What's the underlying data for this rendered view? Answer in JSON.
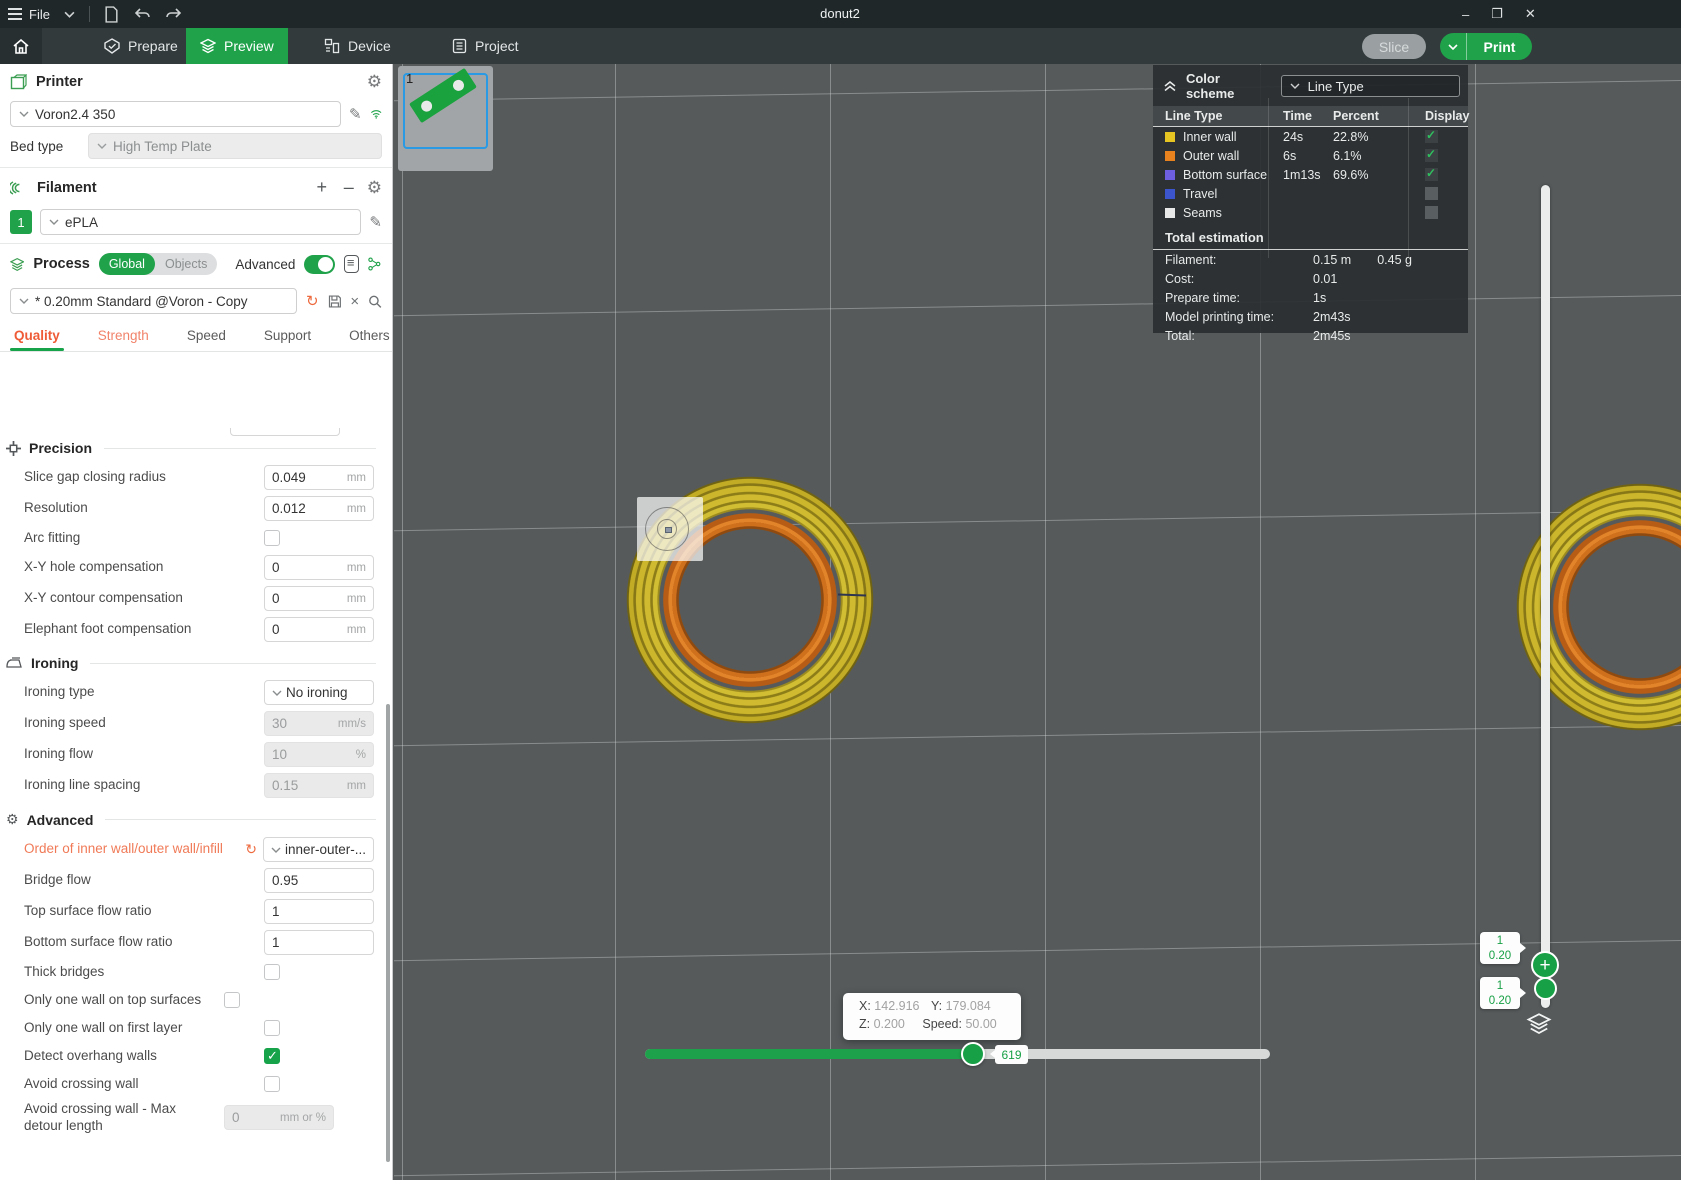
{
  "window": {
    "title": "donut2",
    "minimize": "–",
    "maximize": "❐",
    "close": "✕"
  },
  "menubar": {
    "file_label": "File"
  },
  "nav": {
    "tabs": [
      {
        "label": "Prepare"
      },
      {
        "label": "Preview"
      },
      {
        "label": "Device"
      },
      {
        "label": "Project"
      }
    ],
    "slice_label": "Slice",
    "print_label": "Print"
  },
  "printer": {
    "section_title": "Printer",
    "name": "Voron2.4 350",
    "bed_type_label": "Bed type",
    "bed_type": "High Temp Plate"
  },
  "filament": {
    "section_title": "Filament",
    "slot": "1",
    "name": "ePLA",
    "add": "+",
    "remove": "–"
  },
  "process": {
    "section_title": "Process",
    "global_label": "Global",
    "objects_label": "Objects",
    "advanced_label": "Advanced",
    "preset": "* 0.20mm Standard @Voron - Copy",
    "tabs": [
      "Quality",
      "Strength",
      "Speed",
      "Support",
      "Others"
    ]
  },
  "settings": {
    "precision": {
      "title": "Precision",
      "rows": [
        {
          "label": "Slice gap closing radius",
          "value": "0.049",
          "unit": "mm"
        },
        {
          "label": "Resolution",
          "value": "0.012",
          "unit": "mm"
        },
        {
          "label": "Arc fitting",
          "checked": false
        },
        {
          "label": "X-Y hole compensation",
          "value": "0",
          "unit": "mm"
        },
        {
          "label": "X-Y contour compensation",
          "value": "0",
          "unit": "mm"
        },
        {
          "label": "Elephant foot compensation",
          "value": "0",
          "unit": "mm"
        }
      ]
    },
    "ironing": {
      "title": "Ironing",
      "rows": [
        {
          "label": "Ironing type",
          "value": "No ironing"
        },
        {
          "label": "Ironing speed",
          "value": "30",
          "unit": "mm/s",
          "disabled": true
        },
        {
          "label": "Ironing flow",
          "value": "10",
          "unit": "%",
          "disabled": true
        },
        {
          "label": "Ironing line spacing",
          "value": "0.15",
          "unit": "mm",
          "disabled": true
        }
      ]
    },
    "advanced": {
      "title": "Advanced",
      "rows": [
        {
          "label": "Order of inner wall/outer wall/infill",
          "value": "inner-outer-...",
          "modified": true
        },
        {
          "label": "Bridge flow",
          "value": "0.95"
        },
        {
          "label": "Top surface flow ratio",
          "value": "1"
        },
        {
          "label": "Bottom surface flow ratio",
          "value": "1"
        },
        {
          "label": "Thick bridges",
          "checked": false
        },
        {
          "label": "Only one wall on top surfaces",
          "checked": false
        },
        {
          "label": "Only one wall on first layer",
          "checked": false
        },
        {
          "label": "Detect overhang walls",
          "checked": true
        },
        {
          "label": "Avoid crossing wall",
          "checked": false
        },
        {
          "label": "Avoid crossing wall - Max detour length",
          "value": "0",
          "unit": "mm or %",
          "disabled": true
        }
      ]
    }
  },
  "plate": {
    "number": "1"
  },
  "legend": {
    "header": "Color scheme",
    "scheme_selected": "Line Type",
    "columns": [
      "Line Type",
      "Time",
      "Percent",
      "Display"
    ],
    "rows": [
      {
        "name": "Inner wall",
        "color": "#e6c421",
        "time": "24s",
        "percent": "22.8%",
        "display": true
      },
      {
        "name": "Outer wall",
        "color": "#e8821e",
        "time": "6s",
        "percent": "6.1%",
        "display": true
      },
      {
        "name": "Bottom surface",
        "color": "#6e5ee0",
        "time": "1m13s",
        "percent": "69.6%",
        "display": true
      },
      {
        "name": "Travel",
        "color": "#3c55cc",
        "time": "",
        "percent": "",
        "display": false
      },
      {
        "name": "Seams",
        "color": "#e8e8e8",
        "time": "",
        "percent": "",
        "display": false
      }
    ],
    "total_title": "Total estimation",
    "totals": [
      {
        "label": "Filament:",
        "value": "0.15 m",
        "value2": "0.45 g"
      },
      {
        "label": "Cost:",
        "value": "0.01",
        "value2": ""
      },
      {
        "label": "Prepare time:",
        "value": "1s",
        "value2": ""
      },
      {
        "label": "Model printing time:",
        "value": "2m43s",
        "value2": ""
      },
      {
        "label": "Total:",
        "value": "2m45s",
        "value2": ""
      }
    ]
  },
  "viewport": {
    "tooltip": {
      "x_label": "X:",
      "x": "142.916",
      "y_label": "Y:",
      "y": "179.084",
      "z_label": "Z:",
      "z": "0.200",
      "speed_label": "Speed:",
      "speed": "50.00"
    },
    "h_slider_value": "619",
    "layer_badge_top": {
      "line1": "1",
      "line2": "0.20"
    },
    "layer_badge_bottom": {
      "line1": "1",
      "line2": "0.20"
    }
  },
  "colors": {
    "accent_green": "#1fa24a",
    "modified_orange": "#ed6a3e",
    "inner_wall_yellow": "#d0bb30",
    "outer_wall_orange": "#cf701d"
  }
}
